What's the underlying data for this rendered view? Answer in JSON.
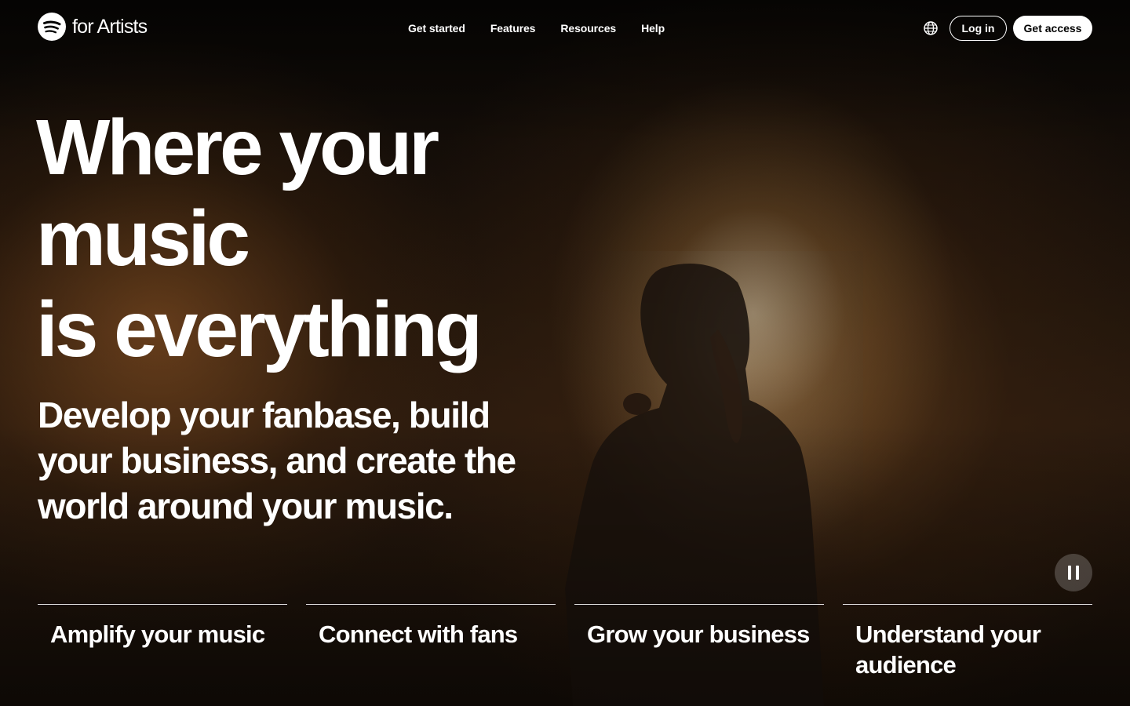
{
  "header": {
    "logo_text": "for Artists",
    "nav": [
      {
        "label": "Get started"
      },
      {
        "label": "Features"
      },
      {
        "label": "Resources"
      },
      {
        "label": "Help"
      }
    ],
    "login_label": "Log in",
    "access_label": "Get access"
  },
  "hero": {
    "headline_lines": [
      "Where your",
      "music",
      "is everything"
    ],
    "subhead": "Develop your fanbase, build your business, and create the world around your music."
  },
  "tabs": [
    {
      "label": "Amplify your music"
    },
    {
      "label": "Connect with fans"
    },
    {
      "label": "Grow your business"
    },
    {
      "label": "Understand your audience"
    }
  ],
  "colors": {
    "text": "#ffffff",
    "primary_button_bg": "#ffffff",
    "primary_button_text": "#000000"
  },
  "icons": {
    "logo": "spotify-logo-icon",
    "language": "globe-icon",
    "video_control": "pause-icon"
  }
}
